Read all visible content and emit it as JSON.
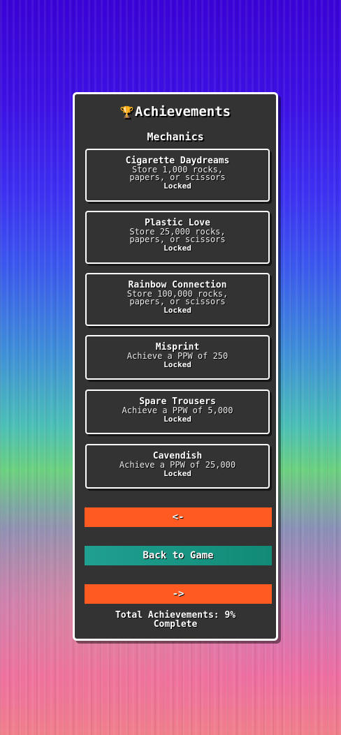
{
  "panel": {
    "title": "Achievements",
    "section": "Mechanics"
  },
  "achievements": [
    {
      "name": "Cigarette Daydreams",
      "desc1": "Store 1,000 rocks,",
      "desc2": "papers, or scissors",
      "status": "Locked"
    },
    {
      "name": "Plastic Love",
      "desc1": "Store 25,000 rocks,",
      "desc2": "papers, or scissors",
      "status": "Locked"
    },
    {
      "name": "Rainbow Connection",
      "desc1": "Store 100,000 rocks,",
      "desc2": "papers, or scissors",
      "status": "Locked"
    },
    {
      "name": "Misprint",
      "desc1": "Achieve a PPW of 250",
      "status": "Locked"
    },
    {
      "name": "Spare Trousers",
      "desc1": "Achieve a PPW of 5,000",
      "status": "Locked"
    },
    {
      "name": "Cavendish",
      "desc1": "Achieve a PPW of 25,000",
      "status": "Locked"
    }
  ],
  "buttons": {
    "prev": "<-",
    "back": "Back to Game",
    "next": "->"
  },
  "footer": {
    "line1": "Total Achievements: 9%",
    "line2": "Complete"
  },
  "colors": {
    "panel": "#333333",
    "orange_button": "#ff5a22",
    "teal_button": "#20a090",
    "trophy": "#f2c230"
  },
  "icons": {
    "title_icon": "trophy-icon"
  }
}
